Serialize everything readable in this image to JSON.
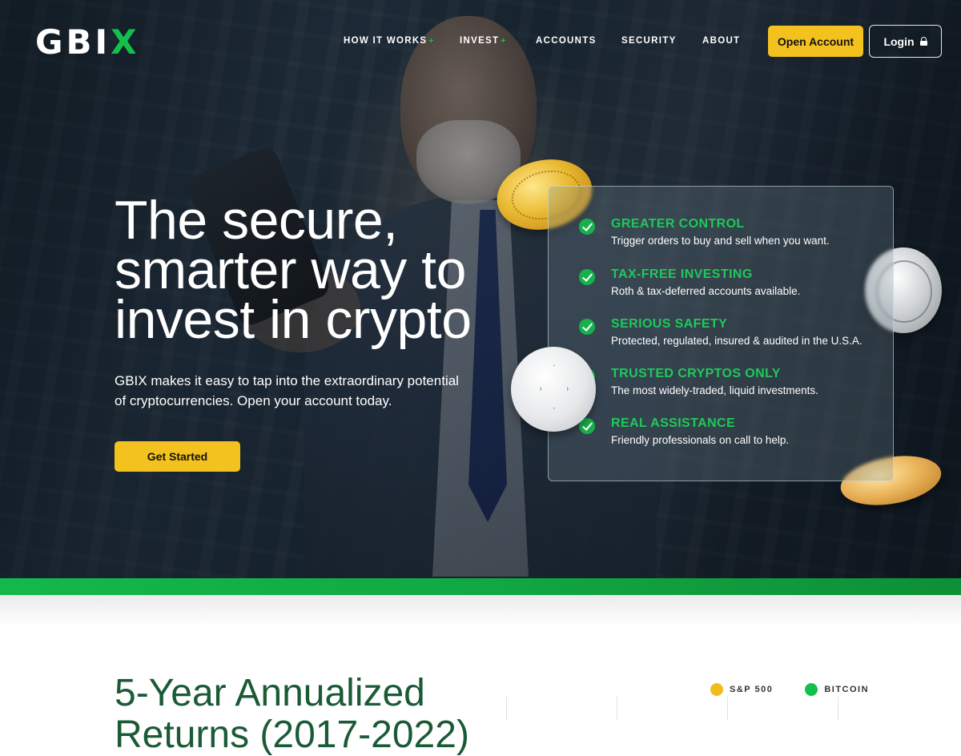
{
  "brand": {
    "logo_text_main": "GBI",
    "logo_text_accent": "X",
    "accent_color": "#12c04d",
    "button_color": "#f3c21e"
  },
  "nav": {
    "items": [
      {
        "label": "HOW IT WORKS",
        "has_dropdown": true
      },
      {
        "label": "INVEST",
        "has_dropdown": true
      },
      {
        "label": "ACCOUNTS",
        "has_dropdown": false
      },
      {
        "label": "SECURITY",
        "has_dropdown": false
      },
      {
        "label": "ABOUT",
        "has_dropdown": false
      }
    ],
    "dropdown_marker": "+",
    "open_account_label": "Open Account",
    "login_label": "Login"
  },
  "hero": {
    "headline_lines": [
      "The secure,",
      "smarter way to",
      "invest in crypto"
    ],
    "subcopy": "GBIX makes it easy to tap into the extraordinary potential of cryptocurrencies. Open your account today.",
    "cta_label": "Get Started"
  },
  "features": [
    {
      "title": "GREATER CONTROL",
      "desc": "Trigger orders to buy and sell when you want."
    },
    {
      "title": "TAX-FREE INVESTING",
      "desc": "Roth & tax-deferred accounts available."
    },
    {
      "title": "SERIOUS SAFETY",
      "desc": "Protected, regulated, insured & audited in the U.S.A."
    },
    {
      "title": "TRUSTED CRYPTOS ONLY",
      "desc": "The most widely-traded, liquid investments."
    },
    {
      "title": "REAL ASSISTANCE",
      "desc": "Friendly professionals on call to help."
    }
  ],
  "returns_section": {
    "title_lines": [
      "5-Year Annualized",
      "Returns (2017-2022)"
    ],
    "legend": [
      {
        "label": "S&P 500",
        "color": "#f0bd1c"
      },
      {
        "label": "BITCOIN",
        "color": "#13c04e"
      }
    ]
  }
}
